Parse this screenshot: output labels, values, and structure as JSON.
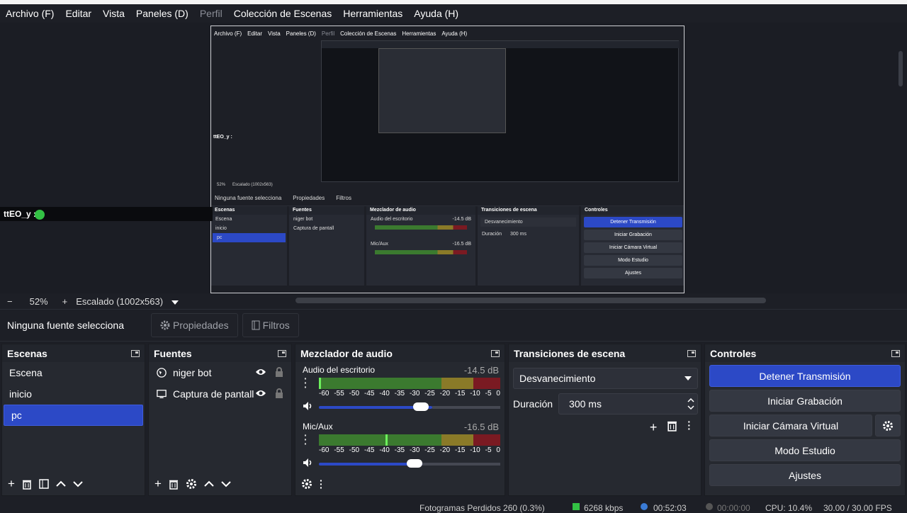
{
  "menu": {
    "items": [
      "Archivo (F)",
      "Editar",
      "Vista",
      "Paneles (D)",
      "Perfil",
      "Colección de Escenas",
      "Herramientas",
      "Ayuda (H)"
    ]
  },
  "chat": {
    "user": "ttEO_y :"
  },
  "preview_toolbar": {
    "minus": "−",
    "zoom": "52%",
    "plus": "+",
    "scaling": "Escalado (1002x563)"
  },
  "source_bar": {
    "label": "Ninguna fuente selecciona",
    "properties": "Propiedades",
    "filters": "Filtros"
  },
  "scenes": {
    "title": "Escenas",
    "items": [
      "Escena",
      "inicio",
      "pc"
    ],
    "selected": "pc"
  },
  "sources": {
    "title": "Fuentes",
    "items": [
      "niger bot",
      "Captura de pantall"
    ]
  },
  "mixer": {
    "title": "Mezclador de audio",
    "tracks": [
      {
        "name": "Audio del escritorio",
        "db": "-14.5 dB",
        "volume_fraction": 0.56
      },
      {
        "name": "Mic/Aux",
        "db": "-16.5 dB",
        "volume_fraction": 0.53
      }
    ],
    "ticks": [
      "-60",
      "-55",
      "-50",
      "-45",
      "-40",
      "-35",
      "-30",
      "-25",
      "-20",
      "-15",
      "-10",
      "-5",
      "0"
    ]
  },
  "transitions": {
    "title": "Transiciones de escena",
    "selected": "Desvanecimiento",
    "duration_label": "Duración",
    "duration_value": "300 ms"
  },
  "controls": {
    "title": "Controles",
    "stop_stream": "Detener Transmisión",
    "start_recording": "Iniciar Grabación",
    "virtual_cam": "Iniciar Cámara Virtual",
    "studio_mode": "Modo Estudio",
    "settings": "Ajustes"
  },
  "status": {
    "dropped": "Fotogramas Perdidos 260 (0.3%)",
    "bitrate": "6268 kbps",
    "stream_time": "00:52:03",
    "rec_time": "00:00:00",
    "cpu": "CPU: 10.4%",
    "fps": "30.00 / 30.00 FPS"
  },
  "nested": {
    "menu": [
      "Archivo (F)",
      "Editar",
      "Vista",
      "Paneles (D)",
      "Perfil",
      "Colección de Escenas",
      "Herramientas",
      "Ayuda (H)"
    ],
    "chat_user": "ttEO_y :",
    "zoom": "52%",
    "scaling": "Escalado (1002x563)",
    "source_label": "Ninguna fuente selecciona",
    "properties": "Propiedades",
    "filters": "Filtros",
    "scenes_title": "Escenas",
    "scenes": [
      "Escena",
      "inicio",
      "pc"
    ],
    "sources_title": "Fuentes",
    "sources": [
      "niger bot",
      "Captura de pantall"
    ],
    "mixer_title": "Mezclador de audio",
    "track1": "Audio del escritorio",
    "track1_db": "-14.5 dB",
    "track2": "Mic/Aux",
    "track2_db": "-16.5 dB",
    "transitions_title": "Transiciones de escena",
    "transition": "Desvanecimiento",
    "duration_label": "Duración",
    "duration_value": "300 ms",
    "controls_title": "Controles",
    "stop_stream": "Detener Transmisión",
    "start_recording": "Iniciar Grabación",
    "virtual_cam": "Iniciar Cámara Virtual",
    "studio_mode": "Modo Estudio",
    "settings": "Ajustes"
  }
}
